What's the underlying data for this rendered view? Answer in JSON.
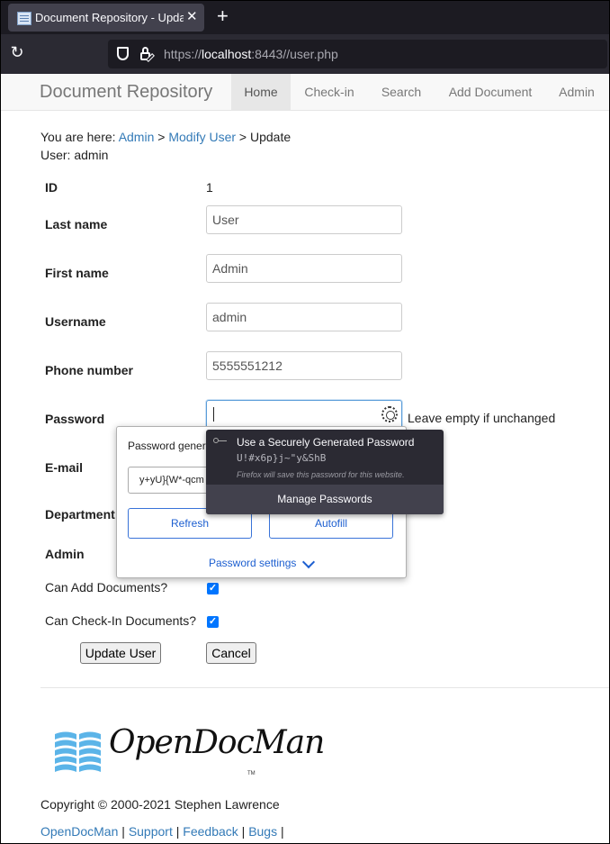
{
  "browser": {
    "tab_title": "Document Repository - Update User",
    "tab_close": "✕",
    "new_tab": "+",
    "reload": "↻",
    "url_scheme": "https://",
    "url_host": "localhost",
    "url_rest": ":8443//user.php"
  },
  "header": {
    "brand": "Document Repository",
    "nav": [
      {
        "label": "Home",
        "active": true
      },
      {
        "label": "Check-in"
      },
      {
        "label": "Search"
      },
      {
        "label": "Add Document"
      },
      {
        "label": "Admin"
      }
    ]
  },
  "breadcrumb": {
    "prefix": "You are here:",
    "item1": "Admin",
    "sep1": ">",
    "item2": "Modify User",
    "sep2": ">",
    "current": "Update"
  },
  "user_line": "User: admin",
  "form": {
    "id_label": "ID",
    "id_value": "1",
    "last_name_label": "Last name",
    "last_name_value": "User",
    "first_name_label": "First name",
    "first_name_value": "Admin",
    "username_label": "Username",
    "username_value": "admin",
    "phone_label": "Phone number",
    "phone_value": "5555551212",
    "password_label": "Password",
    "password_hint": "Leave empty if unchanged",
    "email_label": "E-mail",
    "department_label": "Department",
    "admin_label": "Admin",
    "can_add_label": "Can Add Documents?",
    "can_add_checked": true,
    "can_checkin_label": "Can Check-In Documents?",
    "can_checkin_checked": true,
    "update_button": "Update User",
    "cancel_button": "Cancel",
    "check_glyph": "✓"
  },
  "password_generator": {
    "title": "Password generator",
    "value": "y+yU}{W*-qcm",
    "refresh": "Refresh",
    "autofill": "Autofill",
    "settings": "Password settings"
  },
  "firefox_menu": {
    "title": "Use a Securely Generated Password",
    "password": "U!#x6p}j~\"y&ShB",
    "note": "Firefox will save this password for this website.",
    "manage": "Manage Passwords"
  },
  "footer": {
    "logo_text": "OpenDocMan",
    "tm": "TM",
    "copyright": "Copyright © 2000-2021 Stephen Lawrence",
    "links": [
      "OpenDocMan",
      "Support",
      "Feedback",
      "Bugs"
    ],
    "separator": "|"
  }
}
